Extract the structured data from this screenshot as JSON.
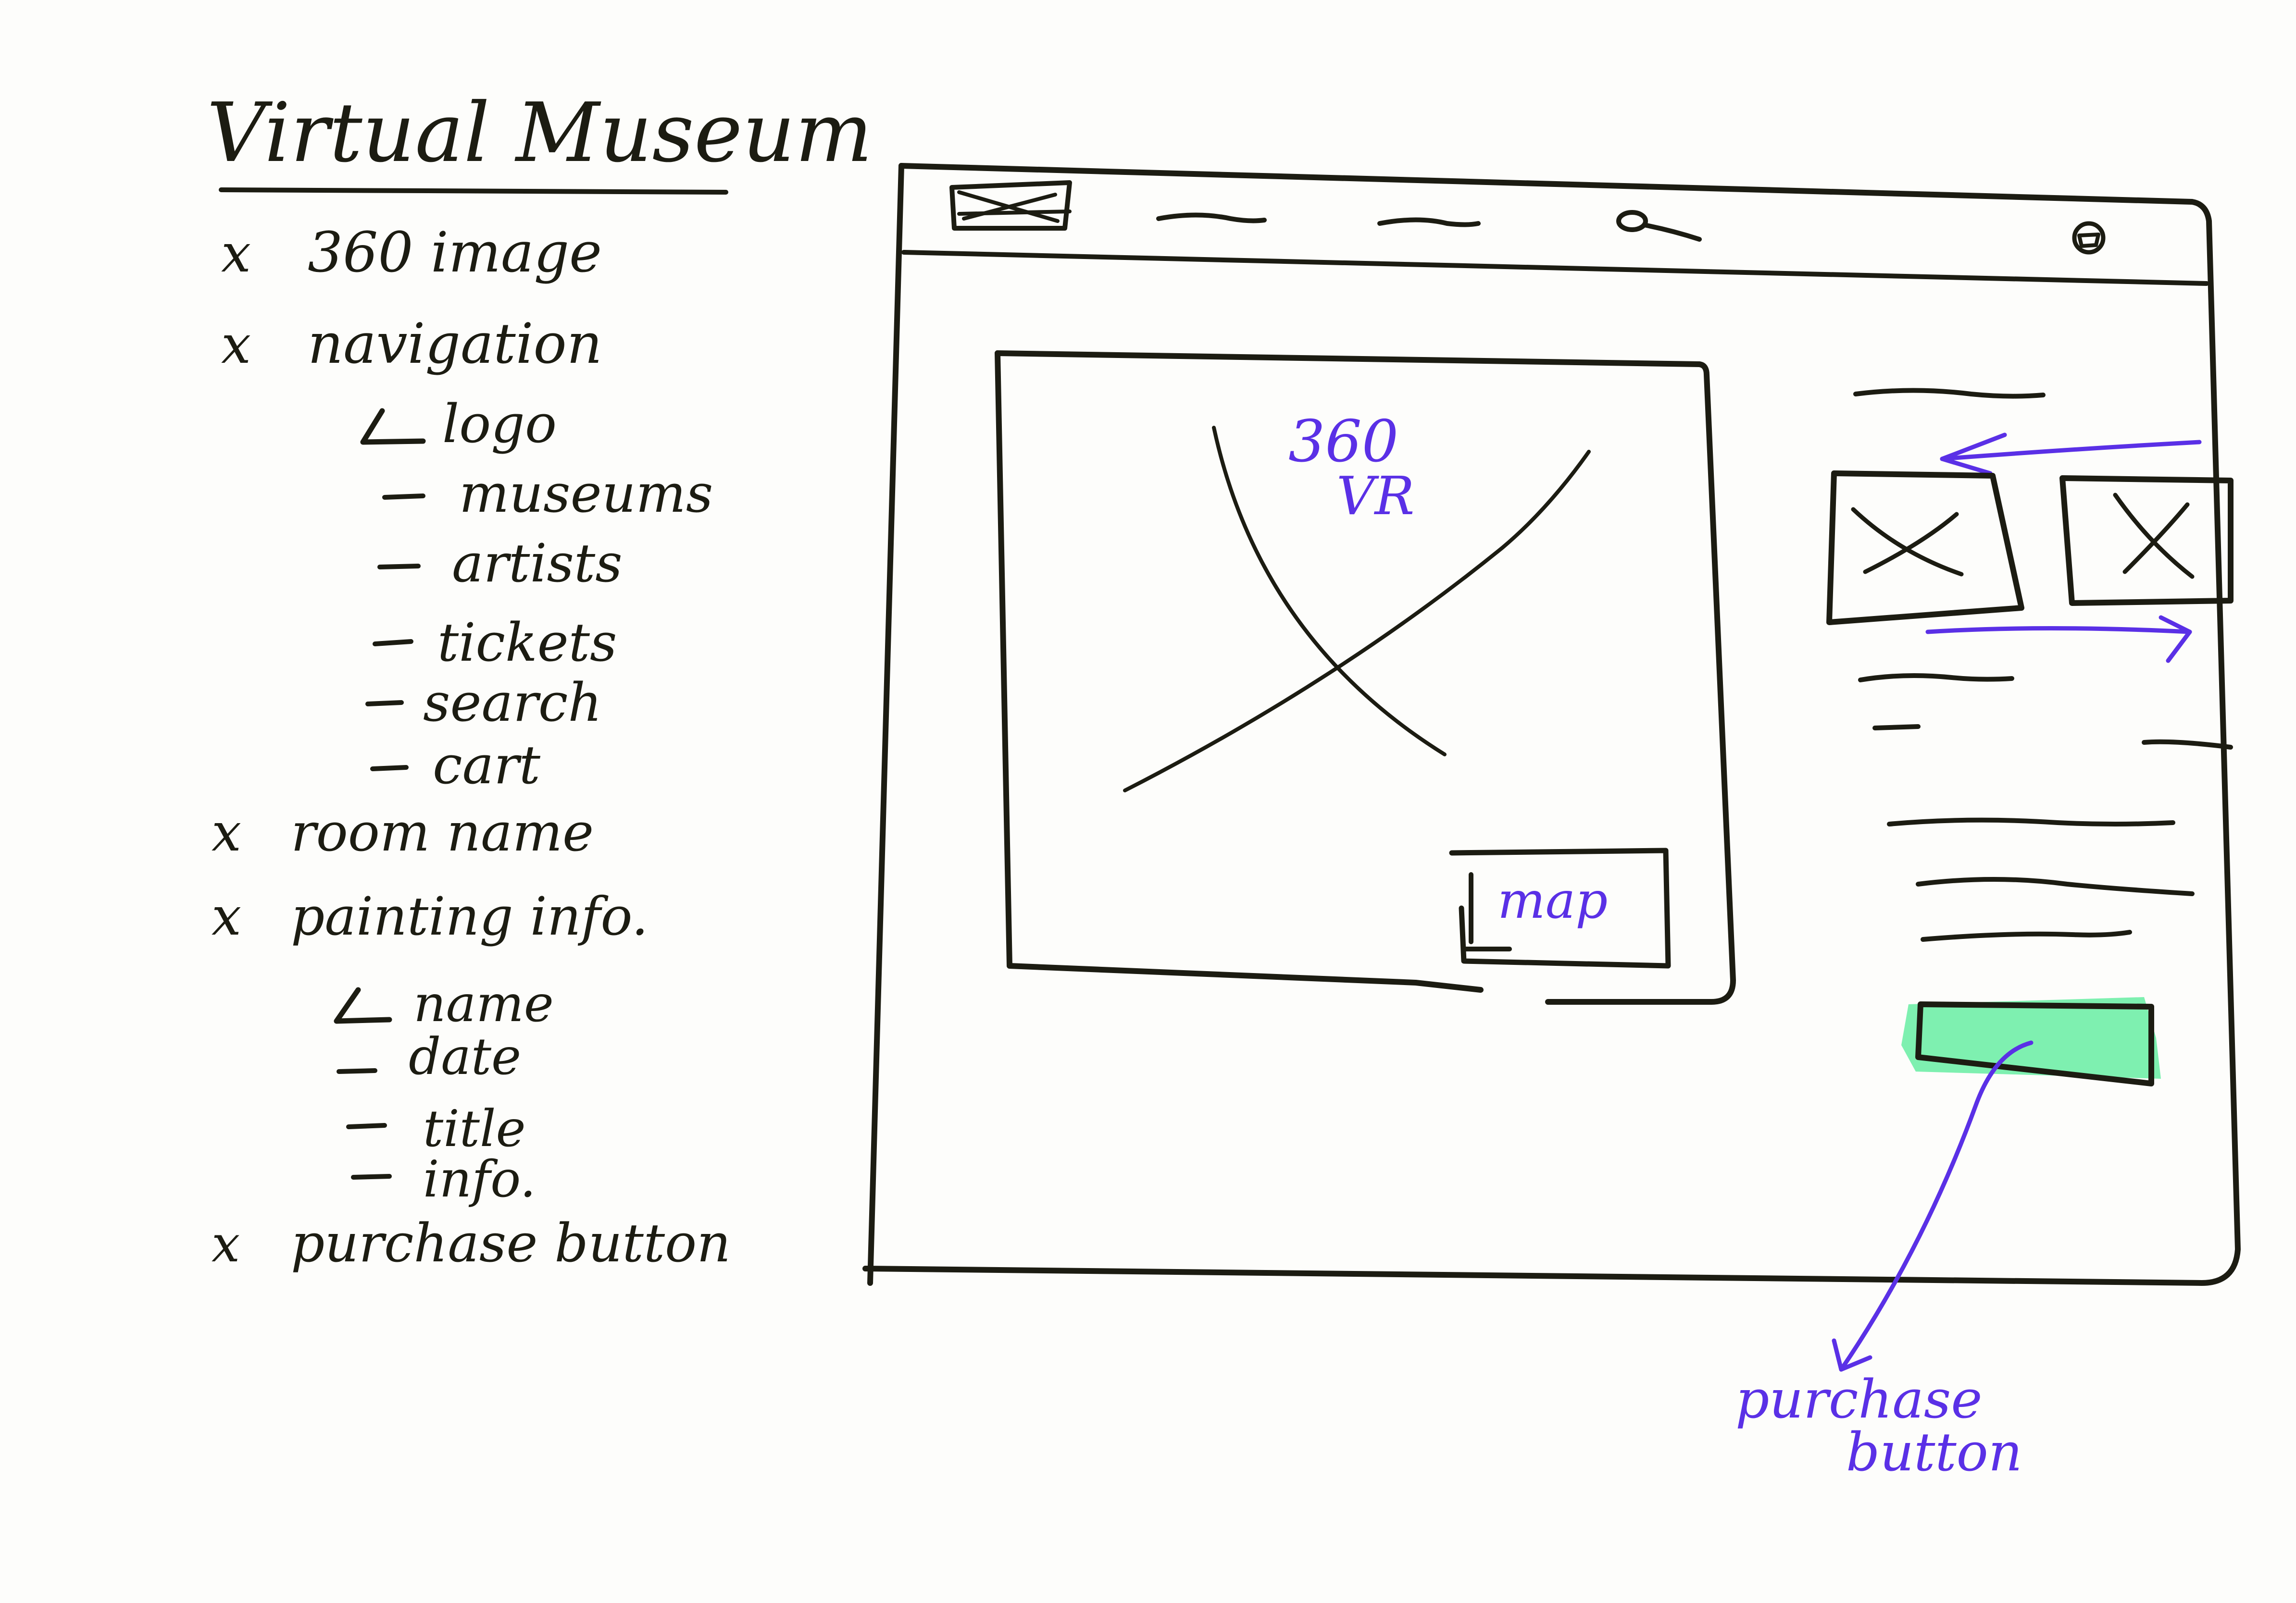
{
  "notes": {
    "title": "Virtual Museum",
    "items": [
      {
        "marker": "x",
        "label": "360 image"
      },
      {
        "marker": "x",
        "label": "navigation"
      },
      {
        "marker": "L",
        "label": "logo"
      },
      {
        "marker": "-",
        "label": "museums"
      },
      {
        "marker": "-",
        "label": "artists"
      },
      {
        "marker": "-",
        "label": "tickets"
      },
      {
        "marker": "-",
        "label": "search"
      },
      {
        "marker": "-",
        "label": "cart"
      },
      {
        "marker": "x",
        "label": "room name"
      },
      {
        "marker": "x",
        "label": "painting info."
      },
      {
        "marker": "L",
        "label": "name"
      },
      {
        "marker": "-",
        "label": "date"
      },
      {
        "marker": "-",
        "label": "title"
      },
      {
        "marker": "-",
        "label": "info."
      },
      {
        "marker": "x",
        "label": "purchase button"
      }
    ]
  },
  "wireframe": {
    "viewer_label_line1": "360",
    "viewer_label_line2": "VR",
    "map_button_label": "map",
    "purchase_annotation_line1": "purchase",
    "purchase_annotation_line2": "button"
  },
  "colors": {
    "ink": "#1c1c12",
    "annotation": "#5a30e6",
    "purchase_highlight": "#7ef0b0",
    "paper": "#fdfdfb"
  },
  "icons": [
    "logo-placeholder-icon",
    "search-icon",
    "cart-icon",
    "image-placeholder-icon",
    "arrow-left-icon",
    "arrow-right-icon"
  ]
}
